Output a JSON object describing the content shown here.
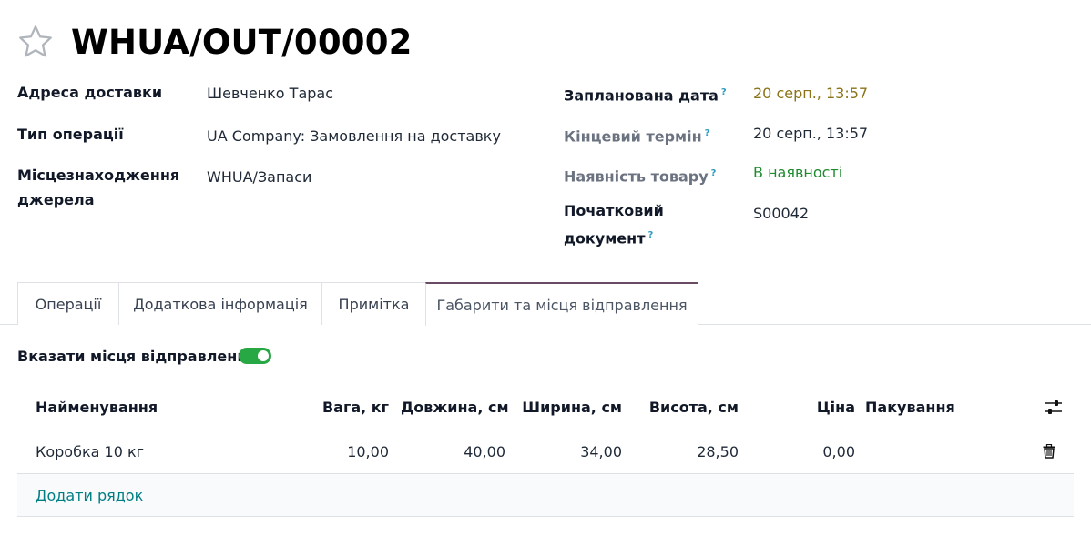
{
  "record": {
    "title": "WHUA/OUT/00002"
  },
  "left_fields": [
    {
      "label": "Адреса доставки",
      "value": "Шевченко Тарас"
    },
    {
      "label": "Тип операції",
      "value": "UA Company: Замовлення на доставку"
    },
    {
      "label_line1": "Місцезнаходження",
      "label_line2": "джерела",
      "value": "WHUA/Запаси"
    }
  ],
  "right_fields": [
    {
      "label": "Запланована дата",
      "help": "?",
      "value": "20 серп., 13:57"
    },
    {
      "label": "Кінцевий термін",
      "help": "?",
      "value": "20 серп., 13:57"
    },
    {
      "label": "Наявність товару",
      "help": "?",
      "value": "В наявності"
    },
    {
      "label_line1": "Початковий",
      "label_line2": "документ",
      "help": "?",
      "value": "S00042"
    }
  ],
  "tabs": [
    {
      "label": "Операції",
      "active": false
    },
    {
      "label": "Додаткова інформація",
      "active": false
    },
    {
      "label": "Примітка",
      "active": false
    },
    {
      "label": "Габарити та місця відправлення",
      "active": true
    }
  ],
  "packages": {
    "toggle_label": "Вказати місця відправлення",
    "toggle_on": true,
    "columns": [
      "Найменування",
      "Вага, кг",
      "Довжина, см",
      "Ширина, см",
      "Висота, см",
      "Ціна",
      "Пакування"
    ],
    "rows": [
      {
        "name": "Коробка 10 кг",
        "weight": "10,00",
        "length": "40,00",
        "width": "34,00",
        "height": "28,50",
        "price": "0,00",
        "packaging": ""
      }
    ],
    "add_line": "Додати рядок"
  },
  "icons": {
    "favorite": "star-outline-icon",
    "settings": "sliders-icon",
    "delete": "trash-icon"
  },
  "colors": {
    "accent": "#6b4c64",
    "link": "#017e84",
    "toggle": "#28a745",
    "scheduled_date": "#8a7318",
    "availability": "#1f8a30"
  }
}
